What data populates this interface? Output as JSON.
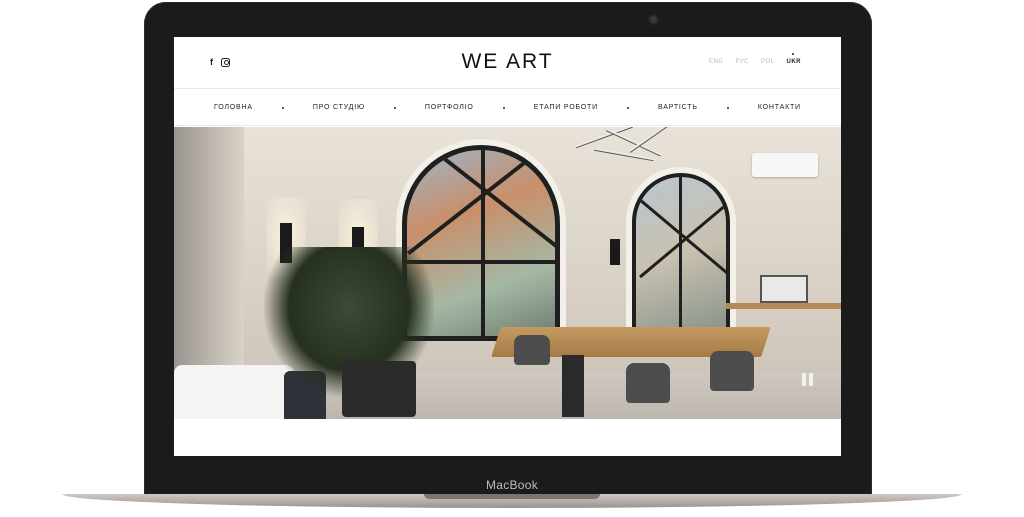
{
  "device": {
    "label": "MacBook"
  },
  "site": {
    "brand": "WE ART",
    "socials": [
      {
        "icon": "facebook-icon",
        "glyph": "f"
      },
      {
        "icon": "instagram-icon"
      }
    ],
    "languages": [
      {
        "code": "ENG",
        "active": false
      },
      {
        "code": "РУС",
        "active": false
      },
      {
        "code": "POL",
        "active": false
      },
      {
        "code": "UKR",
        "active": true
      }
    ],
    "nav": [
      {
        "label": "ГОЛОВНА"
      },
      {
        "label": "ПРО СТУДІЮ"
      },
      {
        "label": "ПОРТФОЛІО"
      },
      {
        "label": "ЕТАПИ РОБОТИ"
      },
      {
        "label": "ВАРТІСТЬ"
      },
      {
        "label": "КОНТАКТИ"
      }
    ]
  },
  "hero": {
    "control": "pause-icon"
  }
}
